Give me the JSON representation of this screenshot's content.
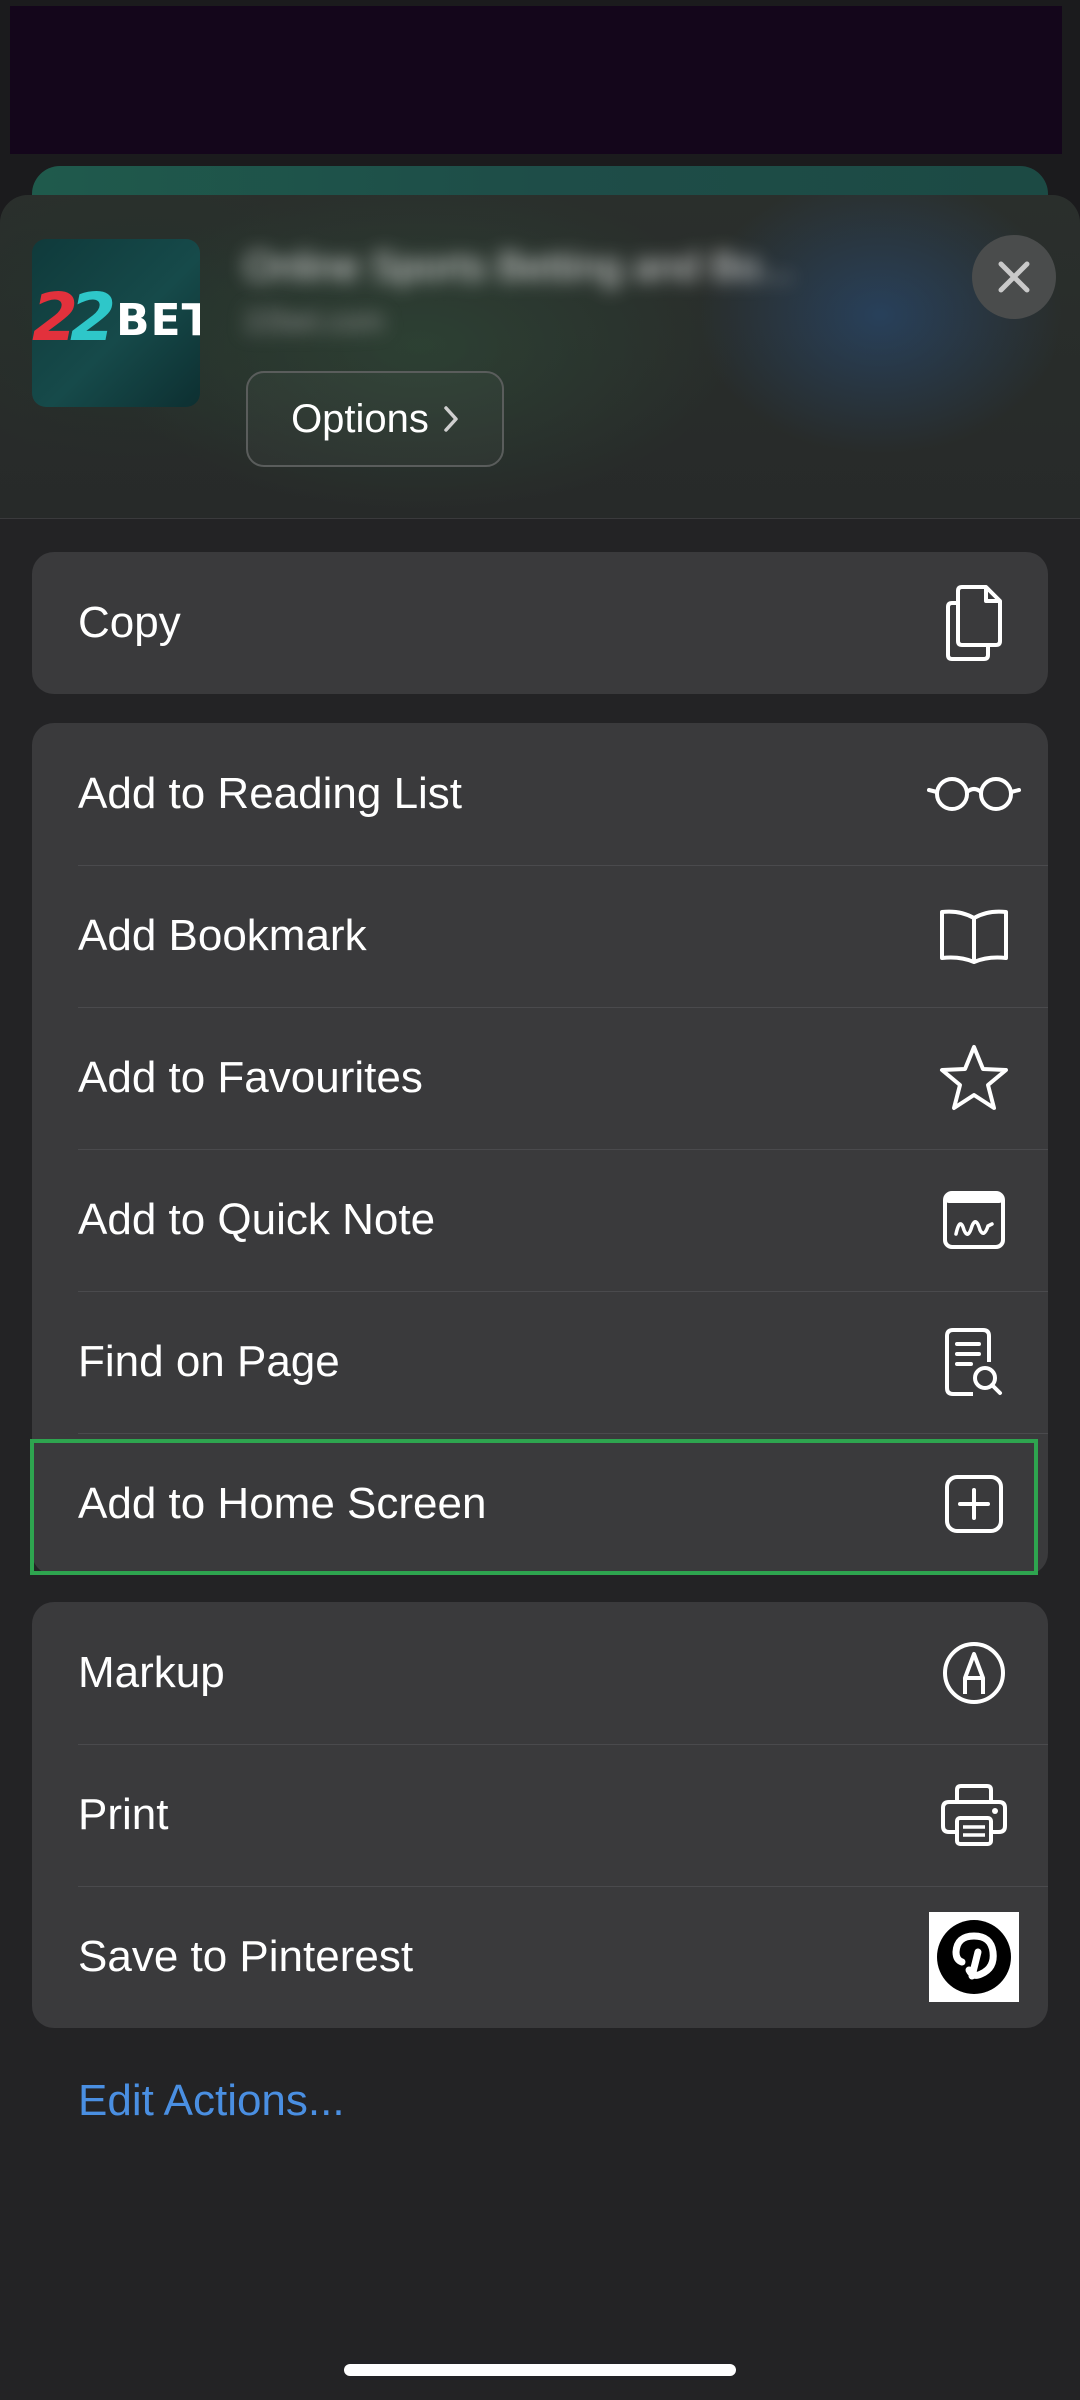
{
  "header": {
    "app_logo_text_two": "22",
    "app_logo_text_bet": "BET",
    "page_title": "Online Sports Betting and Bo...",
    "page_subtitle": "22bet.com",
    "options_label": "Options",
    "options_chevron": "›"
  },
  "groups": [
    {
      "items": [
        {
          "label": "Copy",
          "icon": "copy-icon"
        }
      ]
    },
    {
      "items": [
        {
          "label": "Add to Reading List",
          "icon": "glasses-icon"
        },
        {
          "label": "Add Bookmark",
          "icon": "book-icon"
        },
        {
          "label": "Add to Favourites",
          "icon": "star-icon"
        },
        {
          "label": "Add to Quick Note",
          "icon": "quick-note-icon"
        },
        {
          "label": "Find on Page",
          "icon": "find-document-icon"
        },
        {
          "label": "Add to Home Screen",
          "icon": "plus-square-icon"
        }
      ]
    },
    {
      "items": [
        {
          "label": "Markup",
          "icon": "markup-pen-icon"
        },
        {
          "label": "Print",
          "icon": "printer-icon"
        },
        {
          "label": "Save to Pinterest",
          "icon": "pinterest-icon"
        }
      ]
    }
  ],
  "edit_actions_label": "Edit Actions...",
  "colors": {
    "highlight": "#2ea44f",
    "link": "#4a8fe2",
    "row_bg": "#3a3a3c",
    "sheet_bg": "#232325"
  }
}
